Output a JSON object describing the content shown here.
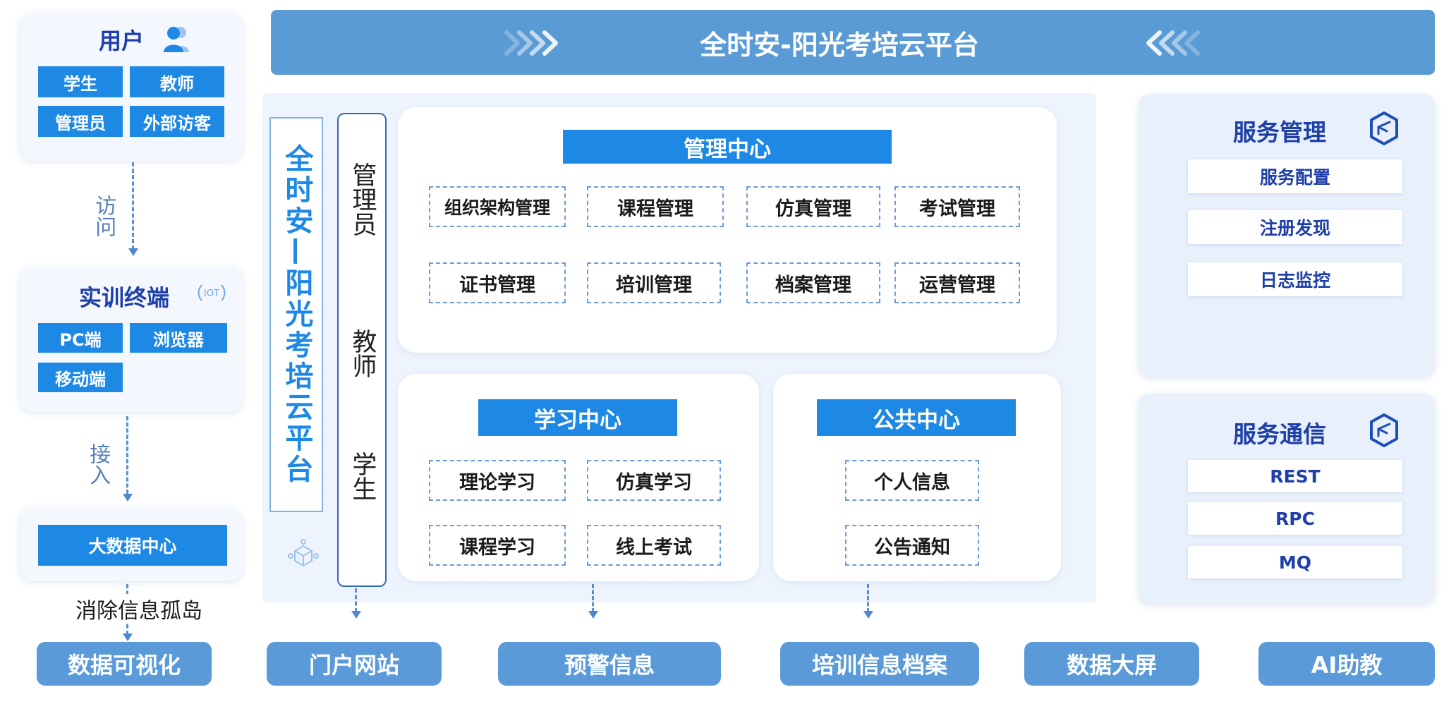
{
  "banner": {
    "title": "全时安-阳光考培云平台"
  },
  "users": {
    "title": "用户",
    "items": [
      "学生",
      "教师",
      "管理员",
      "外部访客"
    ]
  },
  "flow": {
    "access": "访问",
    "connect": "接入",
    "eliminate": "消除信息孤岛"
  },
  "terminal": {
    "title": "实训终端",
    "iot_label": "IOT",
    "items": [
      "PC端",
      "浏览器",
      "移动端"
    ]
  },
  "bigdata": {
    "title": "大数据中心"
  },
  "platform": {
    "vertical_title": "全时安—阳光考培云平台",
    "roles": [
      "管理员",
      "教师",
      "学生"
    ]
  },
  "management": {
    "title": "管理中心",
    "items": [
      "组织架构管理",
      "课程管理",
      "仿真管理",
      "考试管理",
      "证书管理",
      "培训管理",
      "档案管理",
      "运营管理"
    ]
  },
  "learning": {
    "title": "学习中心",
    "items": [
      "理论学习",
      "仿真学习",
      "课程学习",
      "线上考试"
    ]
  },
  "public": {
    "title": "公共中心",
    "items": [
      "个人信息",
      "公告通知"
    ]
  },
  "service_mgmt": {
    "title": "服务管理",
    "items": [
      "服务配置",
      "注册发现",
      "日志监控"
    ]
  },
  "service_comm": {
    "title": "服务通信",
    "items": [
      "REST",
      "RPC",
      "MQ"
    ]
  },
  "outputs": [
    "数据可视化",
    "门户网站",
    "预警信息",
    "培训信息档案",
    "数据大屏",
    "AI助教"
  ],
  "colors": {
    "primary": "#1e88e5",
    "banner": "#5b9bd5",
    "accent_text": "#1e3fa8",
    "output": "#5a9ad9"
  }
}
